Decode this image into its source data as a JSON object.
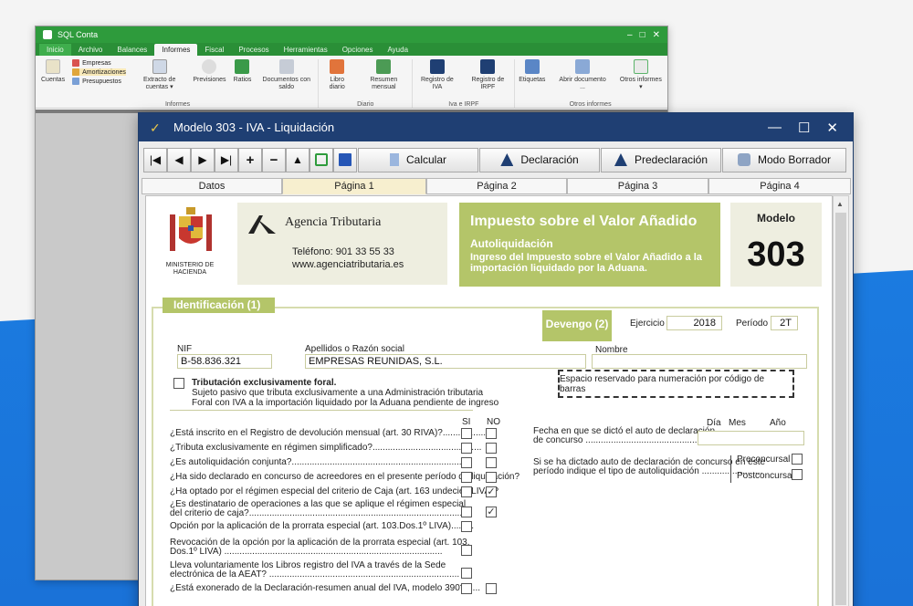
{
  "app_window": {
    "title": "SQL Conta",
    "menu": [
      "Inicio",
      "Archivo",
      "Balances",
      "Informes",
      "Fiscal",
      "Procesos",
      "Herramientas",
      "Opciones",
      "Ayuda"
    ],
    "active_menu": "Informes",
    "ribbon": {
      "informes_group": {
        "label": "Informes",
        "buttons": [
          "Cuentas"
        ],
        "small": [
          "Empresas",
          "Amortizaciones",
          "Presupuestos"
        ],
        "more": [
          "Extracto de cuentas ▾",
          "Previsiones",
          "Ratios",
          "Documentos con saldo"
        ]
      },
      "diario_group": {
        "label": "Diario",
        "buttons": [
          "Libro diario",
          "Resumen mensual"
        ]
      },
      "iva_group": {
        "label": "Iva e IRPF",
        "buttons": [
          "Registro de IVA",
          "Registro de IRPF"
        ]
      },
      "otros_group": {
        "label": "Otros informes",
        "buttons": [
          "Etiquetas",
          "Abrir documento ...",
          "Otros informes ▾"
        ]
      }
    }
  },
  "dialog": {
    "title": "Modelo 303 - IVA - Liquidación",
    "toolbar": {
      "calcular": "Calcular",
      "declaracion": "Declaración",
      "predeclaracion": "Predeclaración",
      "borrador": "Modo Borrador"
    },
    "tabs": [
      "Datos",
      "Página 1",
      "Página 2",
      "Página 3",
      "Página 4"
    ],
    "active_tab": "Página 1"
  },
  "form": {
    "ministerio": "MINISTERIO DE HACIENDA",
    "agencia": "Agencia Tributaria",
    "telefono": "Teléfono: 901 33 55 33",
    "web": "www.agenciatributaria.es",
    "impuesto_title": "Impuesto sobre el Valor Añadido",
    "autoliquidacion": "Autoliquidación",
    "ingreso_text": "Ingreso del Impuesto sobre el Valor Añadido a la importación liquidado por la Aduana.",
    "modelo_label": "Modelo",
    "modelo_num": "303",
    "identificacion": "Identificación (1)",
    "devengo": "Devengo (2)",
    "ejercicio_label": "Ejercicio",
    "ejercicio": "2018",
    "periodo_label": "Período",
    "periodo": "2T",
    "nif_label": "NIF",
    "nif": "B-58.836.321",
    "razon_label": "Apellidos o Razón social",
    "razon": "EMPRESAS REUNIDAS, S.L.",
    "nombre_label": "Nombre",
    "foral_title": "Tributación exclusivamente foral.",
    "foral_text1": "Sujeto pasivo que tributa exclusivamente a una Administración tributaria",
    "foral_text2": "Foral con IVA a la importación liquidado por la Aduana pendiente de ingreso",
    "barcode": "Espacio reservado para numeración por código de barras",
    "si": "SI",
    "no": "NO",
    "questions": [
      {
        "text": "¿Está inscrito en el Registro de devolución mensual (art. 30 RIVA)?..................",
        "si": false,
        "no": false
      },
      {
        "text": "¿Tributa exclusivamente en régimen simplificado?...........................................",
        "si": false,
        "no": false
      },
      {
        "text": "¿Es autoliquidación conjunta?.......................................................................",
        "si": false,
        "no": false
      },
      {
        "text": "¿Ha sido declarado en concurso de acreedores en el presente período de liquidación?",
        "si": false,
        "no": false
      },
      {
        "text": "¿Ha optado por el régimen especial del criterio de Caja (art. 163 undecies LIVA)?",
        "si": false,
        "no": true
      },
      {
        "text": "¿Es destinatario de operaciones a las que se aplique el régimen especial",
        "text2": "del criterio de caja?.....................................................................................",
        "si": false,
        "no": true
      },
      {
        "text": "Opción por la aplicación de la prorrata especial (art. 103.Dos.1º LIVA).........",
        "si": false
      },
      {
        "text": "Revocación de la opción por la aplicación de la prorrata especial (art. 103.",
        "text2": "Dos.1º LIVA) ......................................................................................",
        "si": false
      },
      {
        "text": "Lleva voluntariamente los Libros registro del IVA a través de la Sede",
        "text2": "electrónica de la AEAT? ...........................................................................",
        "si": false
      },
      {
        "text": "¿Está exonerado de la Declaración-resumen anual del IVA, modelo 390?......",
        "si": false,
        "no": false
      }
    ],
    "fecha_label1": "Fecha en que se dictó el auto de declaración",
    "fecha_label2": "de concurso ..................................................",
    "dia": "Día",
    "mes": "Mes",
    "anio": "Año",
    "auto_label1": "Si se ha dictado auto de declaración de concurso en este",
    "auto_label2": "período indique el tipo de autoliquidación ........................",
    "preconcursal": "Preconcursal",
    "postconcursal": "Postconcursal"
  },
  "colors": {
    "accent_green": "#b4c569",
    "title_bar": "#1f3f73",
    "app_green": "#2e9b3c",
    "background_blue": "#1a72d8"
  }
}
